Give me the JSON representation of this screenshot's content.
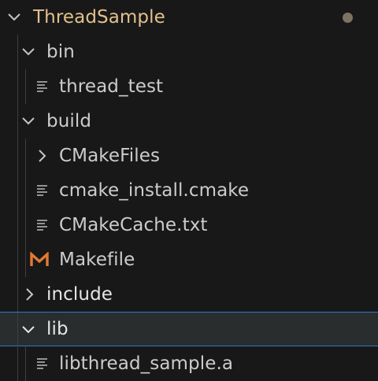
{
  "explorer": {
    "root": {
      "label": "ThreadSample",
      "expanded": true,
      "status": "modified-dot"
    },
    "items": [
      {
        "label": "bin",
        "type": "folder",
        "expanded": true,
        "depth": 1
      },
      {
        "label": "thread_test",
        "type": "file",
        "icon": "text-file-icon",
        "depth": 2
      },
      {
        "label": "build",
        "type": "folder",
        "expanded": true,
        "depth": 1
      },
      {
        "label": "CMakeFiles",
        "type": "folder",
        "expanded": false,
        "depth": 2
      },
      {
        "label": "cmake_install.cmake",
        "type": "file",
        "icon": "text-file-icon",
        "depth": 2
      },
      {
        "label": "CMakeCache.txt",
        "type": "file",
        "icon": "text-file-icon",
        "depth": 2
      },
      {
        "label": "Makefile",
        "type": "file",
        "icon": "makefile-icon",
        "depth": 2
      },
      {
        "label": "include",
        "type": "folder",
        "expanded": false,
        "depth": 1
      },
      {
        "label": "lib",
        "type": "folder",
        "expanded": true,
        "depth": 1,
        "selected": true
      },
      {
        "label": "libthread_sample.a",
        "type": "file",
        "icon": "text-file-icon",
        "depth": 2
      }
    ]
  },
  "colors": {
    "background": "#181818",
    "root_label": "#e2c08d",
    "text": "#cccccc",
    "selection_border": "#2b79d0",
    "makefile_icon": "#e37933",
    "modified_dot": "#7d7363"
  }
}
